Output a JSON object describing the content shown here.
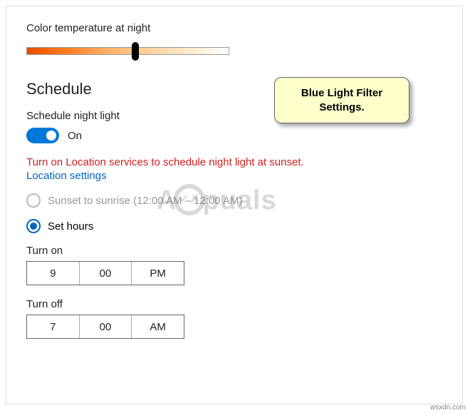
{
  "color_temp": {
    "label": "Color temperature at night"
  },
  "schedule": {
    "title": "Schedule",
    "toggle_label": "Schedule night light",
    "toggle_state": "On",
    "error": "Turn on Location services to schedule night light at sunset.",
    "link": "Location settings",
    "option_sunset": "Sunset to sunrise (12:00 AM – 12:00 AM)",
    "option_hours": "Set hours"
  },
  "turn_on": {
    "label": "Turn on",
    "hour": "9",
    "minute": "00",
    "period": "PM"
  },
  "turn_off": {
    "label": "Turn off",
    "hour": "7",
    "minute": "00",
    "period": "AM"
  },
  "callout": {
    "text": "Blue Light Filter Settings."
  },
  "watermark": {
    "left": "A",
    "right": "puals"
  },
  "source": "wsxdn.com"
}
